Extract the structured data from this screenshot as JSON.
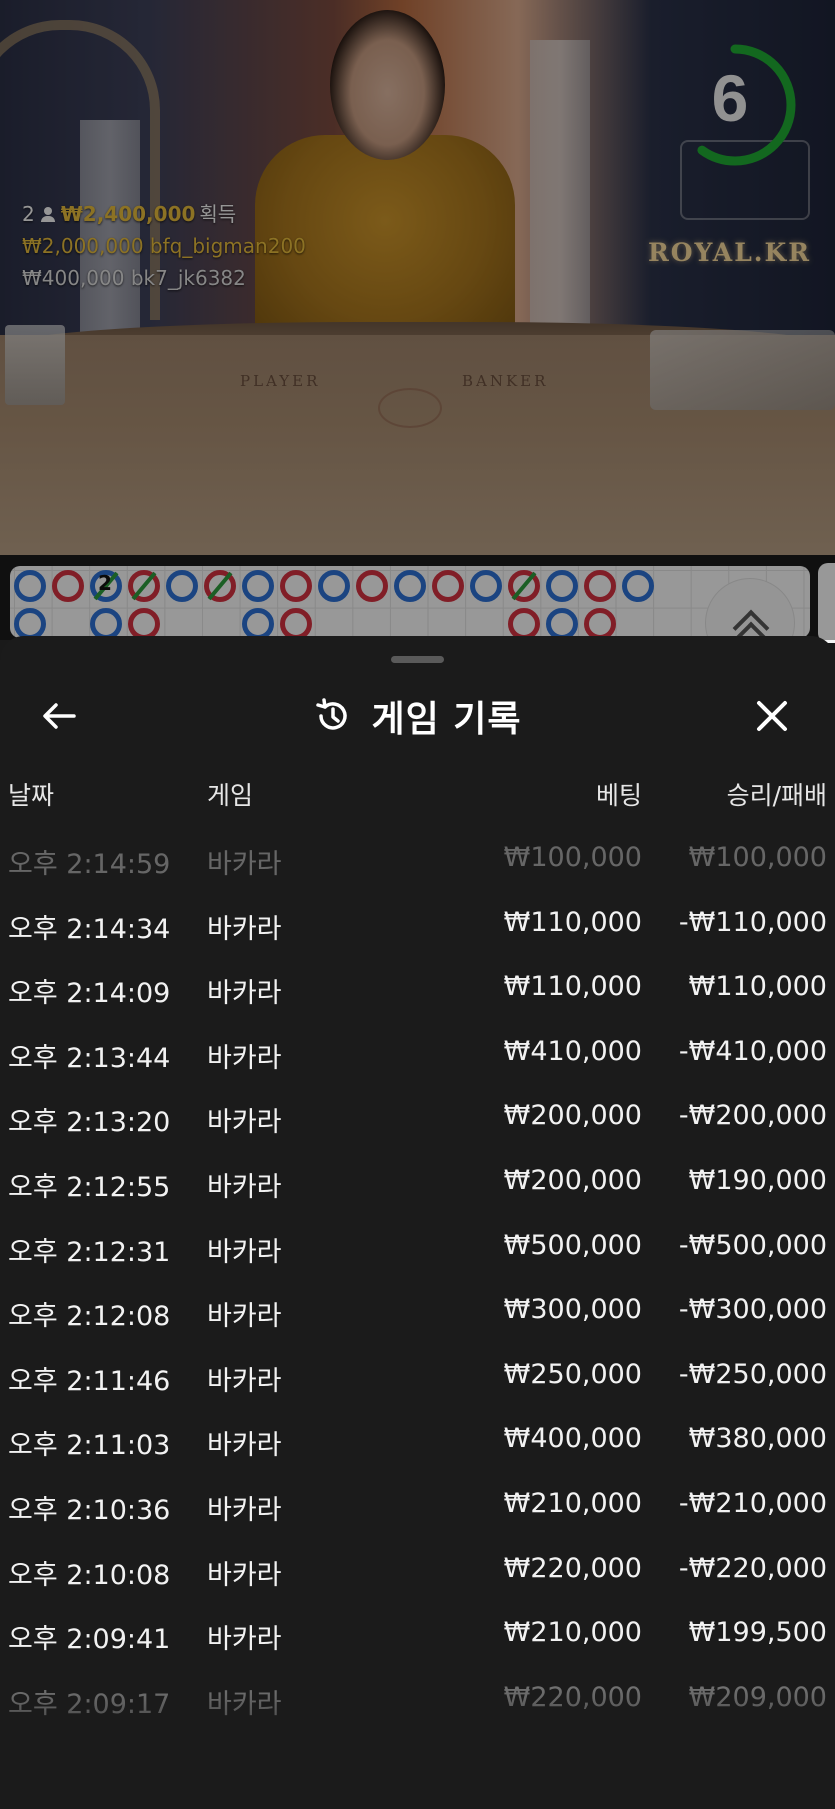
{
  "video": {
    "winners": {
      "count": "2",
      "total": "₩2,400,000",
      "total_suffix": "획득",
      "entries": [
        {
          "amount": "₩2,000,000",
          "user": "bfq_bigman200"
        },
        {
          "amount": "₩400,000",
          "user": "bk7_jk6382"
        }
      ]
    },
    "timer": {
      "value": "6",
      "progress": 0.6,
      "color": "#1fa832"
    },
    "logo": "ROYAL.KR",
    "table_labels": {
      "player": "PLAYER",
      "banker": "BANKER"
    }
  },
  "roadmap": {
    "marker_number": "2",
    "colors": {
      "player": "#2d6fd1",
      "banker": "#d0313f",
      "tie": "#2c9a3c"
    }
  },
  "sheet": {
    "title": "게임 기록",
    "icons": {
      "back": "arrow-left-icon",
      "history": "history-icon",
      "close": "close-icon"
    },
    "columns": {
      "date": "날짜",
      "game": "게임",
      "bet": "베팅",
      "win_loss": "승리/패배"
    },
    "rows": [
      {
        "time": "오후 2:14:59",
        "game": "바카라",
        "bet": "₩100,000",
        "result": "₩100,000"
      },
      {
        "time": "오후 2:14:34",
        "game": "바카라",
        "bet": "₩110,000",
        "result": "-₩110,000"
      },
      {
        "time": "오후 2:14:09",
        "game": "바카라",
        "bet": "₩110,000",
        "result": "₩110,000"
      },
      {
        "time": "오후 2:13:44",
        "game": "바카라",
        "bet": "₩410,000",
        "result": "-₩410,000"
      },
      {
        "time": "오후 2:13:20",
        "game": "바카라",
        "bet": "₩200,000",
        "result": "-₩200,000"
      },
      {
        "time": "오후 2:12:55",
        "game": "바카라",
        "bet": "₩200,000",
        "result": "₩190,000"
      },
      {
        "time": "오후 2:12:31",
        "game": "바카라",
        "bet": "₩500,000",
        "result": "-₩500,000"
      },
      {
        "time": "오후 2:12:08",
        "game": "바카라",
        "bet": "₩300,000",
        "result": "-₩300,000"
      },
      {
        "time": "오후 2:11:46",
        "game": "바카라",
        "bet": "₩250,000",
        "result": "-₩250,000"
      },
      {
        "time": "오후 2:11:03",
        "game": "바카라",
        "bet": "₩400,000",
        "result": "₩380,000"
      },
      {
        "time": "오후 2:10:36",
        "game": "바카라",
        "bet": "₩210,000",
        "result": "-₩210,000"
      },
      {
        "time": "오후 2:10:08",
        "game": "바카라",
        "bet": "₩220,000",
        "result": "-₩220,000"
      },
      {
        "time": "오후 2:09:41",
        "game": "바카라",
        "bet": "₩210,000",
        "result": "₩199,500"
      },
      {
        "time": "오후 2:09:17",
        "game": "바카라",
        "bet": "₩220,000",
        "result": "₩209,000"
      }
    ]
  }
}
